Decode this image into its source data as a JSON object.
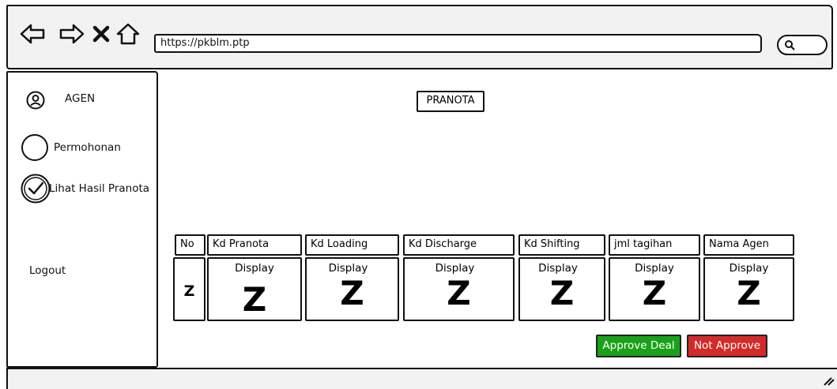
{
  "browser": {
    "url": "https://pkblm.ptp"
  },
  "sidebar": {
    "user_label": "AGEN",
    "items": [
      {
        "label": "Permohonan"
      },
      {
        "label": "Lihat Hasil Pranota"
      }
    ],
    "logout_label": "Logout"
  },
  "main": {
    "title": "PRANOTA",
    "table": {
      "headers": [
        "No",
        "Kd Pranota",
        "Kd Loading",
        "Kd Discharge",
        "Kd Shifting",
        "jml tagihan",
        "Nama Agen"
      ],
      "row": {
        "no": "Z",
        "cells": [
          {
            "display": "Display",
            "value": "Z"
          },
          {
            "display": "Display",
            "value": "Z"
          },
          {
            "display": "Display",
            "value": "Z"
          },
          {
            "display": "Display",
            "value": "Z"
          },
          {
            "display": "Display",
            "value": "Z"
          },
          {
            "display": "Display",
            "value": "Z"
          }
        ]
      }
    },
    "buttons": {
      "approve_label": "Approve Deal",
      "not_approve_label": "Not Approve"
    }
  },
  "colors": {
    "approve": "#1aa11a",
    "not_approve": "#d42a2a",
    "bar": "#f2f2f2"
  }
}
